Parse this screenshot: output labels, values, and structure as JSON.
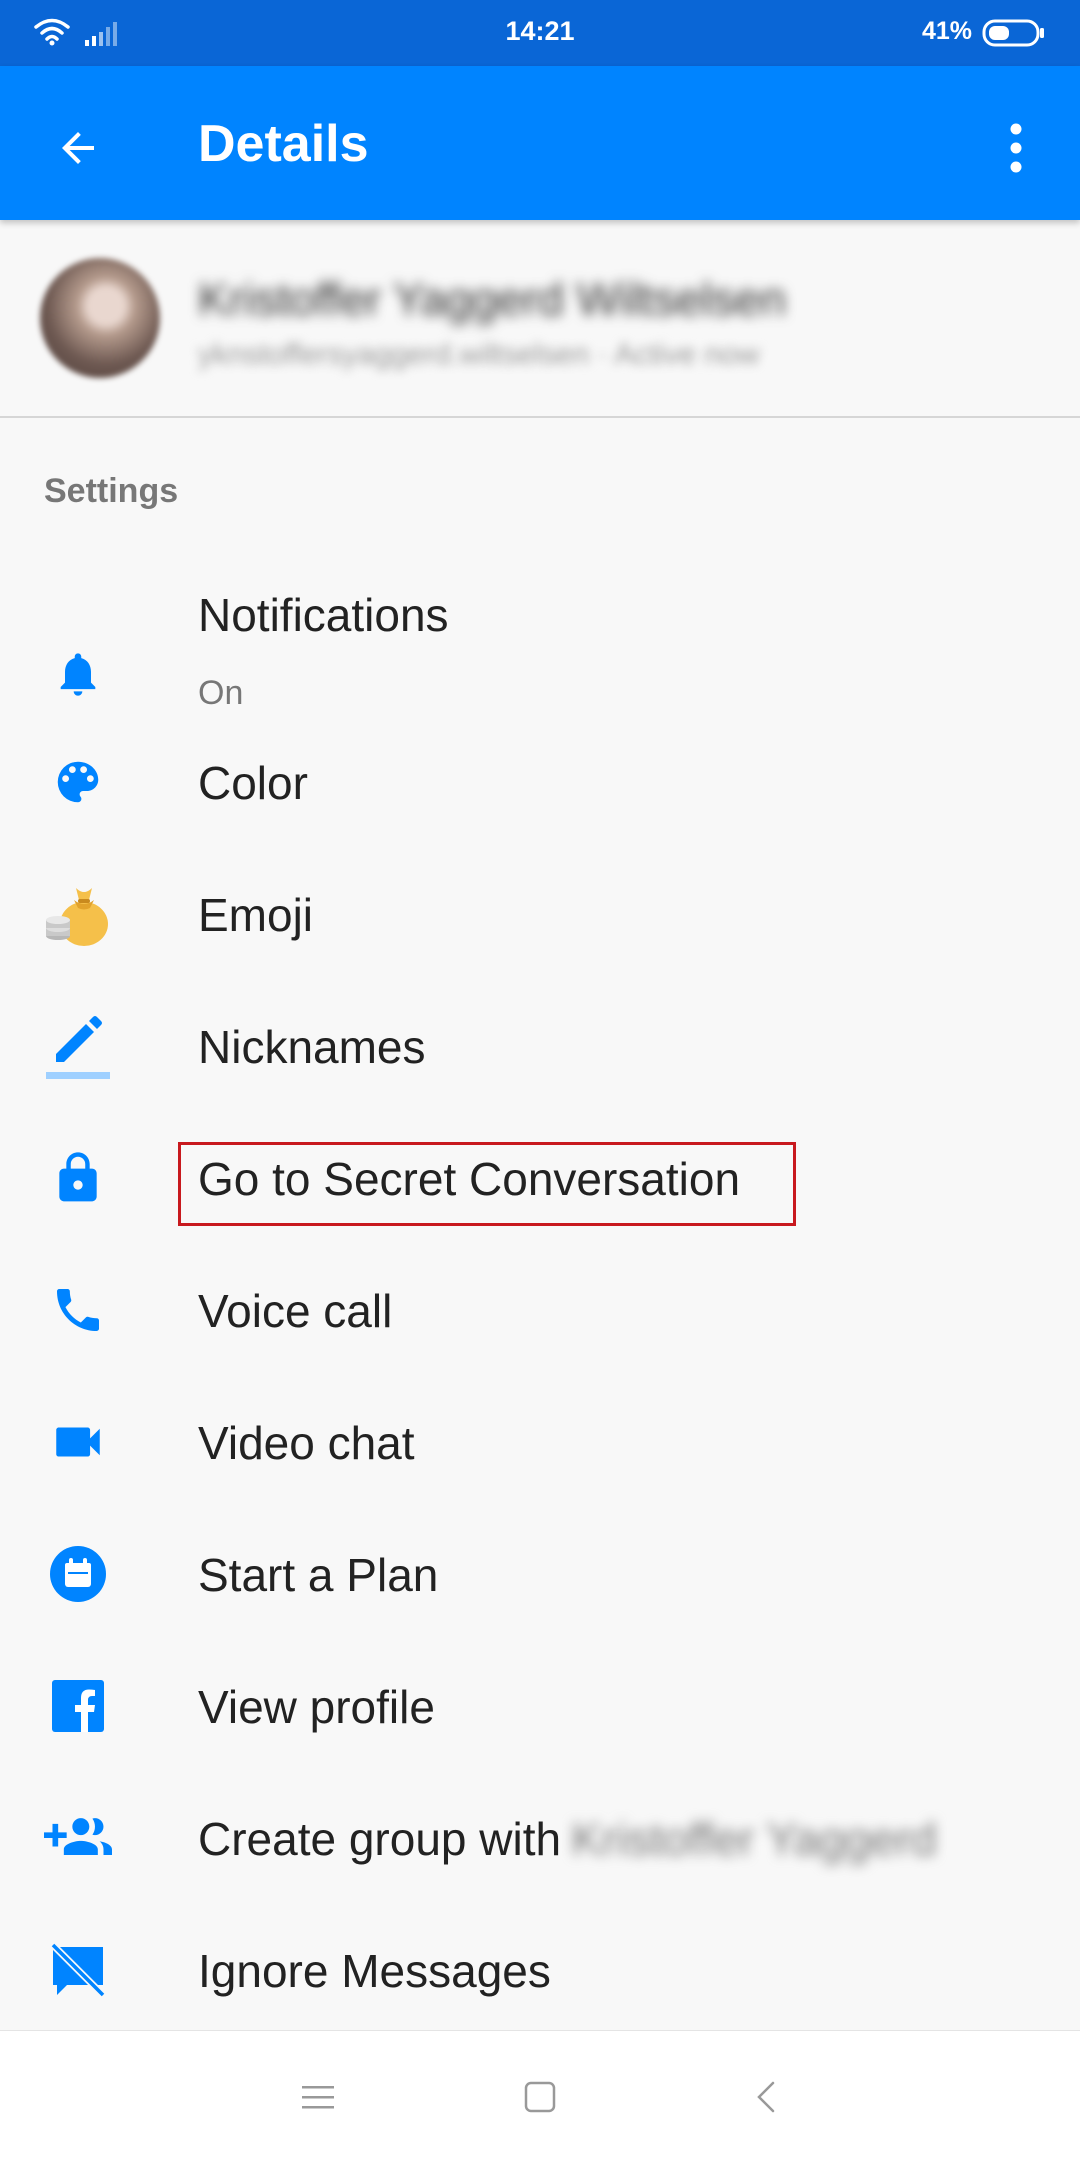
{
  "status_bar": {
    "time": "14:21",
    "battery": "41%"
  },
  "app_bar": {
    "title": "Details",
    "back_icon": "arrow-back-icon",
    "more_icon": "more-vert-icon"
  },
  "profile": {
    "name": "Kristoffer Yaggerd Wiltselsen",
    "subtitle": "yknstoffersyaggerd.wiltselsen · Active now"
  },
  "settings": {
    "header": "Settings",
    "items": [
      {
        "label": "Notifications",
        "sublabel": "On",
        "icon": "bell-icon"
      },
      {
        "label": "Color",
        "icon": "palette-icon"
      },
      {
        "label": "Emoji",
        "icon": "money-bag-emoji-icon"
      },
      {
        "label": "Nicknames",
        "icon": "pencil-icon"
      },
      {
        "label": "Go to Secret Conversation",
        "icon": "lock-icon"
      },
      {
        "label": "Voice call",
        "icon": "phone-icon"
      },
      {
        "label": "Video chat",
        "icon": "video-camera-icon"
      },
      {
        "label": "Start a Plan",
        "icon": "calendar-icon"
      },
      {
        "label": "View profile",
        "icon": "facebook-icon"
      },
      {
        "label": "Create group with",
        "label_suffix": "Kristoffer Yaggerd",
        "icon": "add-group-icon"
      },
      {
        "label": "Ignore Messages",
        "icon": "ignore-messages-icon"
      }
    ]
  },
  "colors": {
    "accent": "#0084FF",
    "status_bar": "#0A66D6",
    "highlight": "#C8191E"
  },
  "nav_bar": {
    "menu_icon": "menu-icon",
    "home_icon": "home-icon",
    "back_icon": "back-icon"
  }
}
